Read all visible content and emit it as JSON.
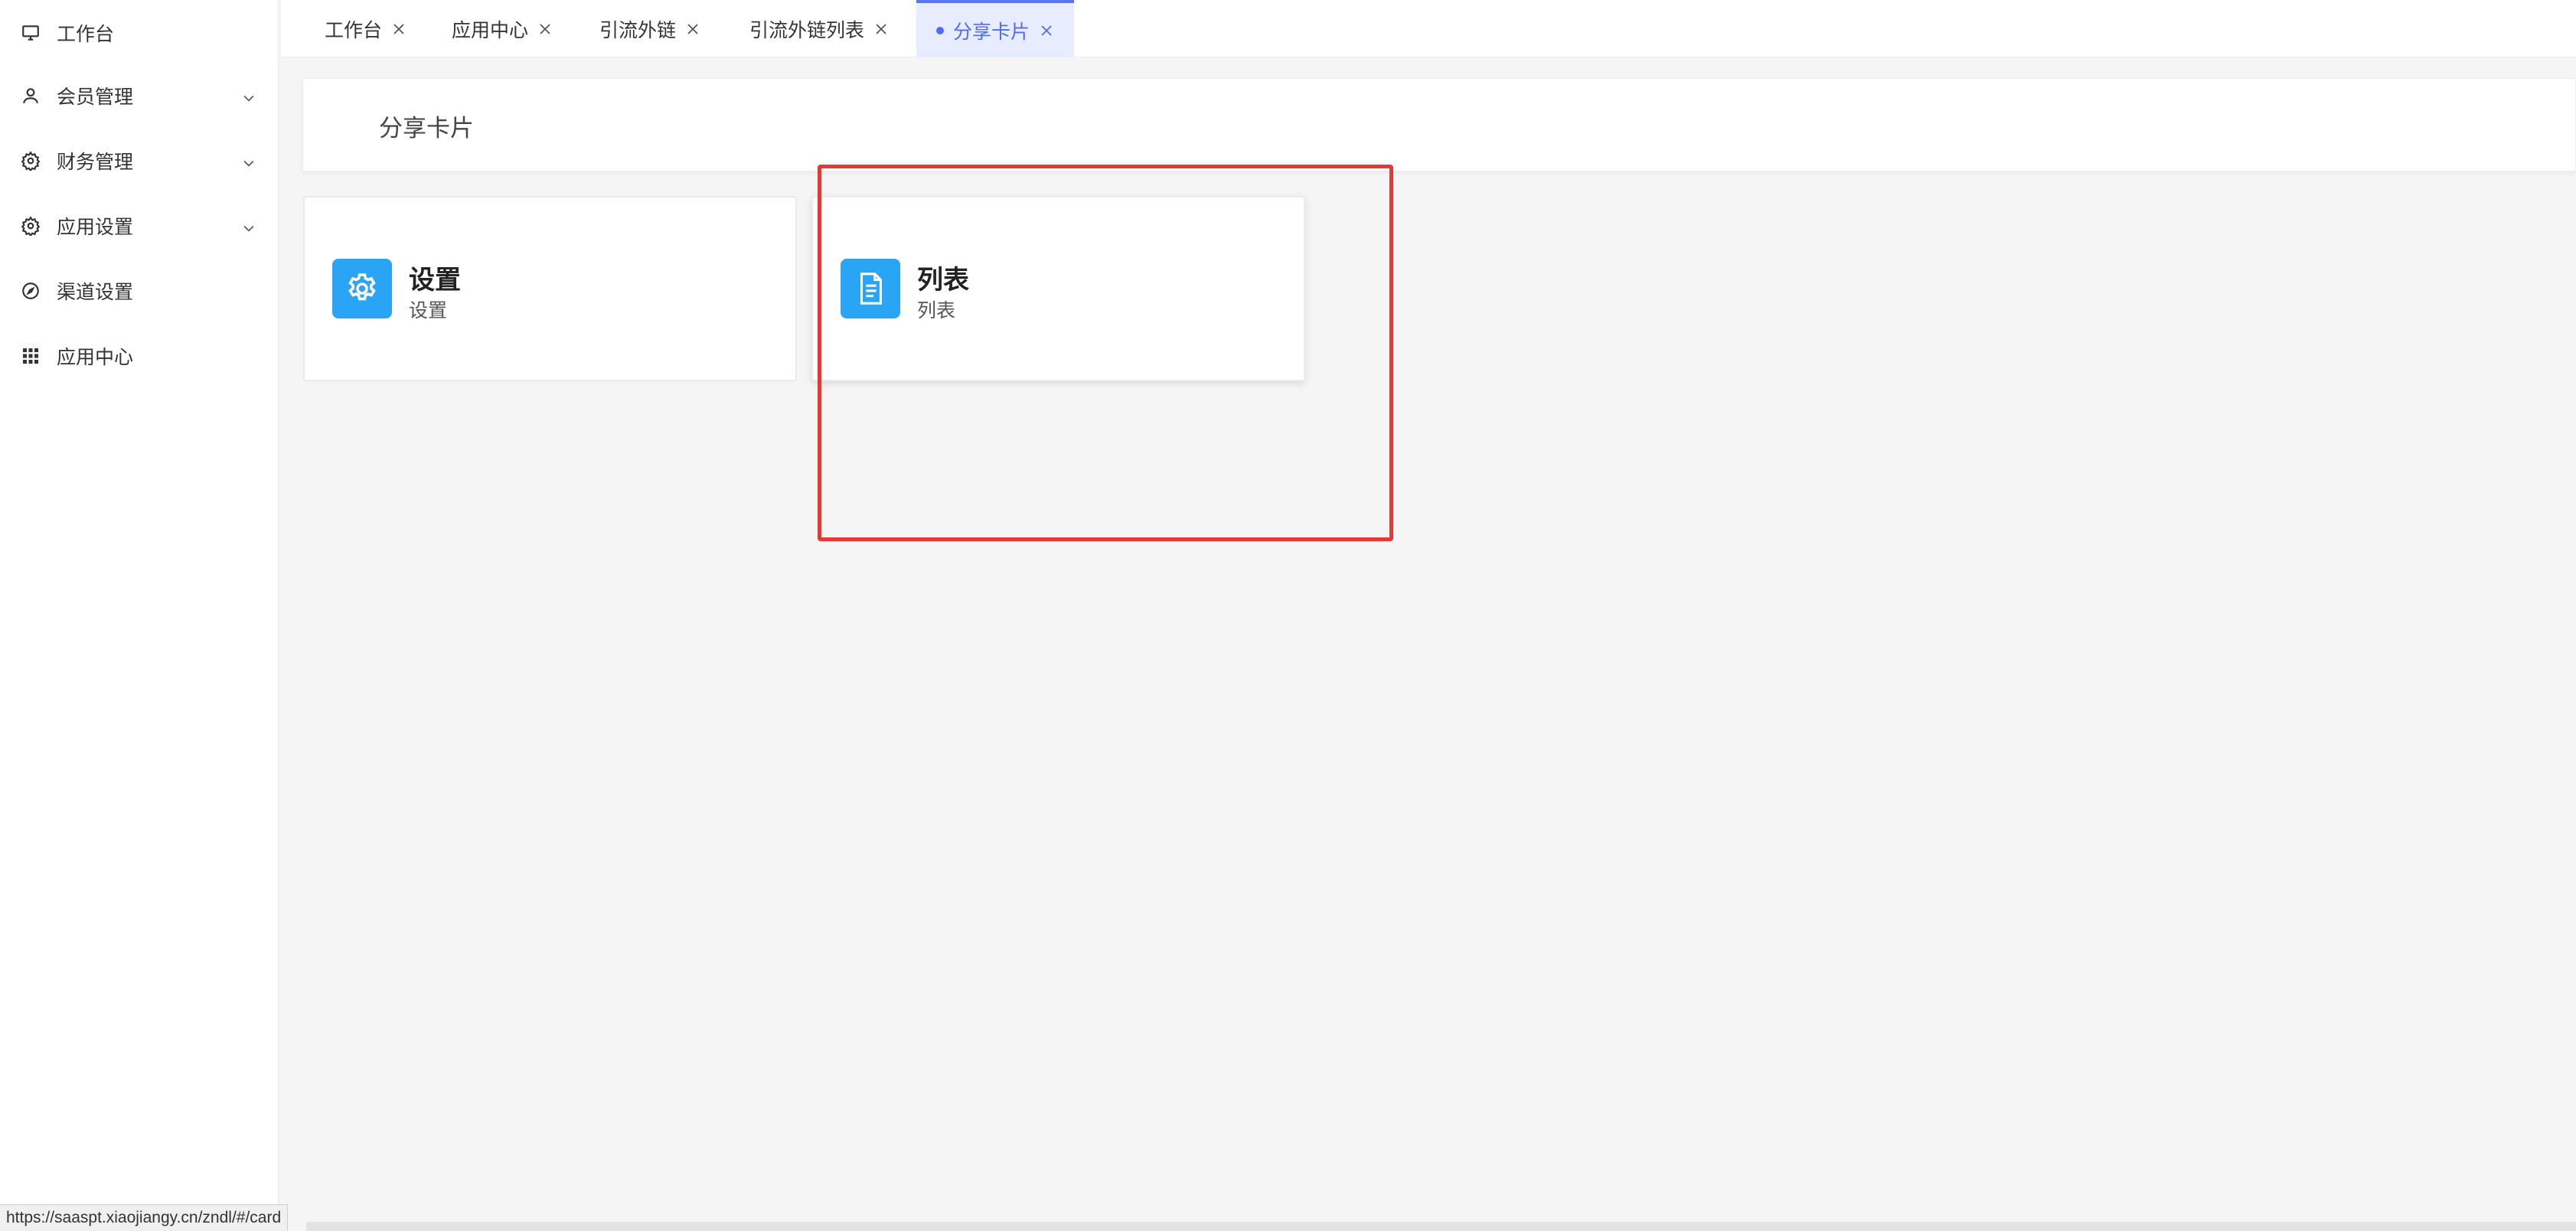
{
  "sidebar": {
    "items": [
      {
        "label": "工作台",
        "icon": "monitor-icon",
        "has_submenu": false
      },
      {
        "label": "会员管理",
        "icon": "user-icon",
        "has_submenu": true
      },
      {
        "label": "财务管理",
        "icon": "gear-icon",
        "has_submenu": true
      },
      {
        "label": "应用设置",
        "icon": "gear-icon",
        "has_submenu": true
      },
      {
        "label": "渠道设置",
        "icon": "compass-icon",
        "has_submenu": false
      },
      {
        "label": "应用中心",
        "icon": "grid-icon",
        "has_submenu": false
      }
    ]
  },
  "tabs": [
    {
      "label": "工作台",
      "active": false
    },
    {
      "label": "应用中心",
      "active": false
    },
    {
      "label": "引流外链",
      "active": false
    },
    {
      "label": "引流外链列表",
      "active": false
    },
    {
      "label": "分享卡片",
      "active": true
    }
  ],
  "page": {
    "title": "分享卡片"
  },
  "cards": [
    {
      "title": "设置",
      "subtitle": "设置",
      "icon": "gear-icon"
    },
    {
      "title": "列表",
      "subtitle": "列表",
      "icon": "document-icon"
    }
  ],
  "status_bar": {
    "url": "https://saaspt.xiaojiangy.cn/zndl/#/card"
  },
  "colors": {
    "accent": "#4f6bf5",
    "active_tab_bg": "#e8ecff",
    "card_icon_bg": "#2aa4f4",
    "highlight": "#e53935"
  }
}
